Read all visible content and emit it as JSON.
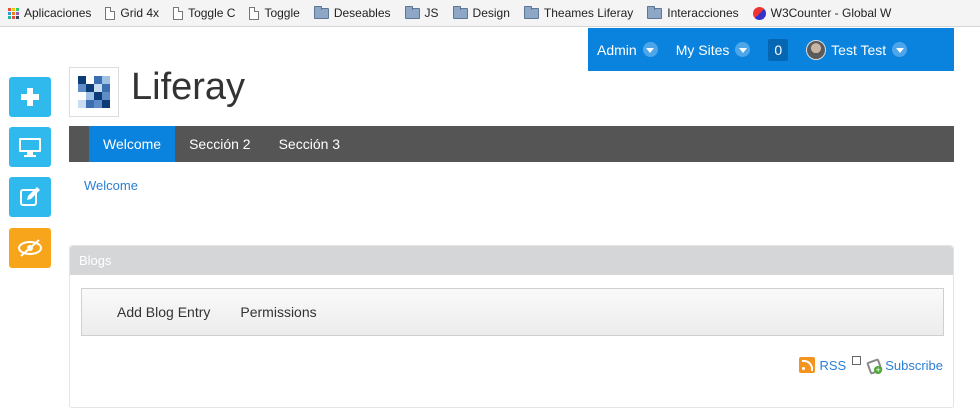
{
  "bookmarks": [
    {
      "label": "Aplicaciones",
      "icon": "apps-grid-icon"
    },
    {
      "label": "Grid 4x",
      "icon": "page-icon"
    },
    {
      "label": "Toggle C",
      "icon": "page-icon"
    },
    {
      "label": "Toggle",
      "icon": "page-icon"
    },
    {
      "label": "Deseables",
      "icon": "folder-icon"
    },
    {
      "label": "JS",
      "icon": "folder-icon"
    },
    {
      "label": "Design",
      "icon": "folder-icon"
    },
    {
      "label": "Theames Liferay",
      "icon": "folder-icon"
    },
    {
      "label": "Interacciones",
      "icon": "folder-icon"
    },
    {
      "label": "W3Counter - Global W",
      "icon": "w3counter-icon"
    }
  ],
  "dock": {
    "admin": "Admin",
    "my_sites": "My Sites",
    "notifications": "0",
    "user": "Test Test"
  },
  "left_toolbar": [
    {
      "name": "add-button",
      "icon": "plus-icon",
      "color": "#2fb9ec"
    },
    {
      "name": "preview-button",
      "icon": "monitor-icon",
      "color": "#2fb9ec"
    },
    {
      "name": "edit-controls-button",
      "icon": "edit-icon",
      "color": "#2fb9ec"
    },
    {
      "name": "toggle-controls-button",
      "icon": "eye-slash-icon",
      "color": "#f7a51a"
    }
  ],
  "site": {
    "title": "Liferay"
  },
  "nav": {
    "items": [
      {
        "label": "Welcome",
        "active": true
      },
      {
        "label": "Sección 2",
        "active": false
      },
      {
        "label": "Sección 3",
        "active": false
      }
    ]
  },
  "breadcrumb": "Welcome",
  "blogs": {
    "title": "Blogs",
    "add_entry": "Add Blog Entry",
    "permissions": "Permissions",
    "rss": "RSS",
    "subscribe": "Subscribe"
  },
  "colors": {
    "accent": "#0a83df",
    "nav_bg": "#555555",
    "toolbar_blue": "#2fb9ec",
    "toolbar_orange": "#f7a51a",
    "link": "#2a7fd6"
  }
}
